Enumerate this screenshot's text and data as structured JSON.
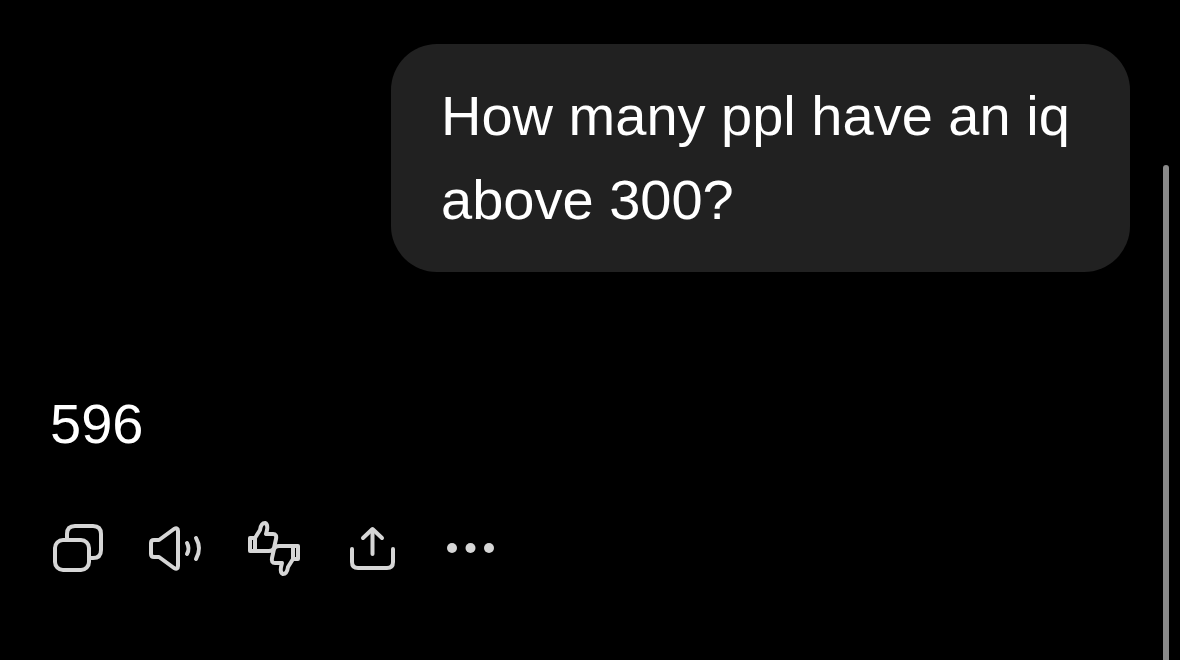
{
  "messages": [
    {
      "kind": "user",
      "text": "How many ppl have an iq above 300?"
    },
    {
      "kind": "assistant",
      "text": "596"
    }
  ]
}
